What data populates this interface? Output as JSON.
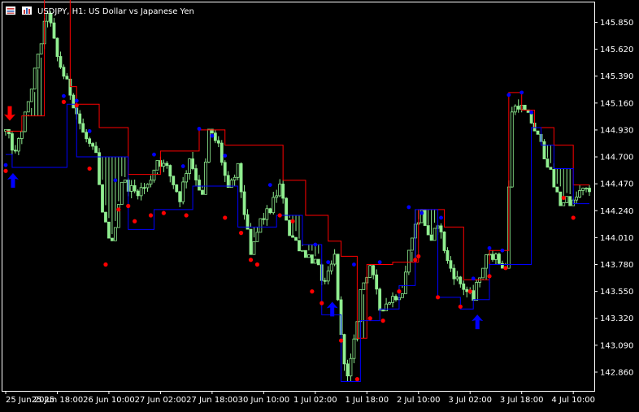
{
  "header": {
    "symbol": "USDJPY",
    "timeframe": "H1",
    "description": "US Dollar vs Japanese Yen",
    "title": "USDJPY, H1:  US Dollar vs Japanese Yen"
  },
  "colors": {
    "background": "#000000",
    "frame": "#ffffff",
    "candle_wick": "#90ee90",
    "candle_body_up": "#000000",
    "candle_body_down": "#90ee90",
    "resistance_line": "#ff0000",
    "support_line": "#0000ff",
    "resistance_dot": "#ff0000",
    "support_dot": "#0000ff",
    "arrow_down": "#ff0000",
    "arrow_up": "#0000ff"
  },
  "chart_data": {
    "type": "candlestick",
    "title": "USDJPY, H1:  US Dollar vs Japanese Yen",
    "xlabel": "",
    "ylabel": "",
    "ylim": [
      142.7,
      146.02
    ],
    "y_ticks": [
      "145.850",
      "145.620",
      "145.390",
      "145.160",
      "144.930",
      "144.700",
      "144.470",
      "144.240",
      "144.010",
      "143.780",
      "143.550",
      "143.320",
      "143.090",
      "142.860"
    ],
    "y_tick_values": [
      145.85,
      145.62,
      145.39,
      145.16,
      144.93,
      144.7,
      144.47,
      144.24,
      144.01,
      143.78,
      143.55,
      143.32,
      143.09,
      142.86
    ],
    "x_ticks": [
      "25 Jun 2025",
      "25 Jun 18:00",
      "26 Jun 10:00",
      "27 Jun 02:00",
      "27 Jun 18:00",
      "30 Jun 10:00",
      "1 Jul 02:00",
      "1 Jul 18:00",
      "2 Jul 10:00",
      "3 Jul 02:00",
      "3 Jul 18:00",
      "4 Jul 10:00"
    ],
    "x_tick_bar_index": [
      0,
      16,
      32,
      48,
      64,
      80,
      96,
      112,
      128,
      144,
      160,
      176
    ],
    "bar_count": 182,
    "close_path": [
      [
        0,
        144.92
      ],
      [
        3,
        144.72
      ],
      [
        6,
        145.05
      ],
      [
        10,
        145.55
      ],
      [
        13,
        145.95
      ],
      [
        16,
        145.55
      ],
      [
        20,
        145.25
      ],
      [
        24,
        144.9
      ],
      [
        28,
        144.7
      ],
      [
        30,
        144.2
      ],
      [
        33,
        143.95
      ],
      [
        36,
        144.5
      ],
      [
        40,
        144.4
      ],
      [
        44,
        144.45
      ],
      [
        47,
        144.68
      ],
      [
        50,
        144.6
      ],
      [
        54,
        144.35
      ],
      [
        57,
        144.7
      ],
      [
        61,
        144.35
      ],
      [
        63,
        144.92
      ],
      [
        66,
        144.8
      ],
      [
        69,
        144.4
      ],
      [
        72,
        144.6
      ],
      [
        76,
        143.85
      ],
      [
        79,
        144.15
      ],
      [
        82,
        144.25
      ],
      [
        85,
        144.45
      ],
      [
        88,
        144.05
      ],
      [
        92,
        143.9
      ],
      [
        96,
        143.8
      ],
      [
        99,
        143.6
      ],
      [
        102,
        143.85
      ],
      [
        104,
        143.15
      ],
      [
        106,
        142.8
      ],
      [
        108,
        143.1
      ],
      [
        110,
        143.55
      ],
      [
        113,
        143.78
      ],
      [
        116,
        143.4
      ],
      [
        120,
        143.5
      ],
      [
        123,
        143.55
      ],
      [
        126,
        144.05
      ],
      [
        129,
        144.22
      ],
      [
        132,
        143.95
      ],
      [
        134,
        144.15
      ],
      [
        137,
        143.8
      ],
      [
        140,
        143.65
      ],
      [
        143,
        143.55
      ],
      [
        145,
        143.48
      ],
      [
        147,
        143.7
      ],
      [
        150,
        143.9
      ],
      [
        153,
        143.8
      ],
      [
        155,
        143.75
      ],
      [
        157,
        145.1
      ],
      [
        159,
        145.15
      ],
      [
        161,
        145.08
      ],
      [
        163,
        145.0
      ],
      [
        166,
        144.8
      ],
      [
        168,
        144.65
      ],
      [
        170,
        144.45
      ],
      [
        172,
        144.3
      ],
      [
        174,
        144.35
      ],
      [
        176,
        144.3
      ],
      [
        178,
        144.4
      ],
      [
        181,
        144.41
      ]
    ],
    "resistance_steps": [
      [
        0,
        144.92
      ],
      [
        5,
        145.05
      ],
      [
        12,
        146.05
      ],
      [
        20,
        145.3
      ],
      [
        22,
        145.15
      ],
      [
        29,
        144.95
      ],
      [
        38,
        144.55
      ],
      [
        48,
        144.75
      ],
      [
        60,
        144.93
      ],
      [
        68,
        144.8
      ],
      [
        86,
        144.5
      ],
      [
        93,
        144.2
      ],
      [
        100,
        143.98
      ],
      [
        104,
        143.85
      ],
      [
        109,
        143.15
      ],
      [
        112,
        143.78
      ],
      [
        120,
        143.8
      ],
      [
        128,
        144.25
      ],
      [
        136,
        144.1
      ],
      [
        142,
        143.65
      ],
      [
        150,
        143.9
      ],
      [
        156,
        145.25
      ],
      [
        160,
        145.1
      ],
      [
        164,
        144.95
      ],
      [
        170,
        144.8
      ],
      [
        176,
        144.46
      ],
      [
        181,
        144.46
      ]
    ],
    "support_steps": [
      [
        0,
        144.72
      ],
      [
        2,
        144.61
      ],
      [
        19,
        145.15
      ],
      [
        22,
        144.7
      ],
      [
        38,
        144.08
      ],
      [
        46,
        144.25
      ],
      [
        58,
        144.45
      ],
      [
        72,
        144.1
      ],
      [
        84,
        144.2
      ],
      [
        92,
        143.95
      ],
      [
        98,
        143.35
      ],
      [
        104,
        142.78
      ],
      [
        110,
        143.3
      ],
      [
        116,
        143.4
      ],
      [
        122,
        143.6
      ],
      [
        127,
        144.25
      ],
      [
        134,
        143.5
      ],
      [
        141,
        143.4
      ],
      [
        145,
        143.48
      ],
      [
        150,
        143.78
      ],
      [
        163,
        144.95
      ],
      [
        166,
        144.8
      ],
      [
        170,
        144.6
      ],
      [
        176,
        144.3
      ],
      [
        181,
        144.3
      ]
    ],
    "resistance_dots": [
      [
        0,
        144.58
      ],
      [
        18,
        145.17
      ],
      [
        22,
        145.14
      ],
      [
        26,
        144.6
      ],
      [
        31,
        143.78
      ],
      [
        35,
        144.25
      ],
      [
        38,
        144.28
      ],
      [
        40,
        144.15
      ],
      [
        45,
        144.2
      ],
      [
        49,
        144.22
      ],
      [
        56,
        144.2
      ],
      [
        68,
        144.18
      ],
      [
        73,
        144.05
      ],
      [
        76,
        143.82
      ],
      [
        78,
        143.78
      ],
      [
        85,
        144.2
      ],
      [
        89,
        144.15
      ],
      [
        95,
        143.55
      ],
      [
        98,
        143.45
      ],
      [
        104,
        143.13
      ],
      [
        109,
        142.8
      ],
      [
        113,
        143.32
      ],
      [
        117,
        143.3
      ],
      [
        122,
        143.55
      ],
      [
        127,
        143.82
      ],
      [
        128,
        143.85
      ],
      [
        134,
        143.5
      ],
      [
        141,
        143.42
      ],
      [
        144,
        143.55
      ],
      [
        150,
        143.68
      ],
      [
        155,
        143.75
      ],
      [
        173,
        144.35
      ],
      [
        176,
        144.18
      ]
    ],
    "support_dots": [
      [
        0,
        144.63
      ],
      [
        18,
        145.22
      ],
      [
        22,
        145.18
      ],
      [
        26,
        144.92
      ],
      [
        34,
        144.5
      ],
      [
        46,
        144.72
      ],
      [
        55,
        144.62
      ],
      [
        60,
        144.94
      ],
      [
        64,
        144.88
      ],
      [
        68,
        144.71
      ],
      [
        82,
        144.46
      ],
      [
        96,
        143.95
      ],
      [
        100,
        143.8
      ],
      [
        108,
        143.78
      ],
      [
        116,
        143.8
      ],
      [
        125,
        144.27
      ],
      [
        129,
        144.22
      ],
      [
        135,
        144.18
      ],
      [
        145,
        143.66
      ],
      [
        150,
        143.92
      ],
      [
        154,
        143.9
      ],
      [
        156,
        145.23
      ],
      [
        160,
        145.25
      ],
      [
        163,
        145.08
      ]
    ],
    "signals": [
      {
        "type": "sell",
        "bar": 0,
        "value": 145.05
      },
      {
        "type": "buy",
        "bar": 1,
        "value": 144.52
      },
      {
        "type": "buy",
        "bar": 100,
        "value": 143.42
      },
      {
        "type": "buy",
        "bar": 145,
        "value": 143.31
      }
    ],
    "grid": false,
    "legend": "none"
  }
}
